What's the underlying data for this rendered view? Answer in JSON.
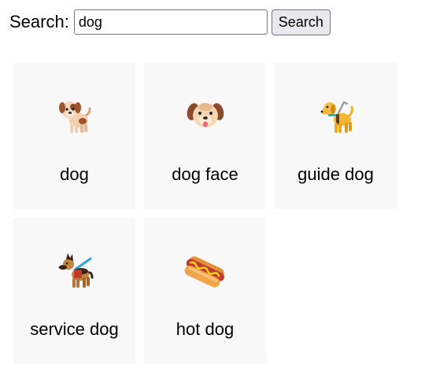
{
  "search": {
    "label": "Search:",
    "value": "dog",
    "button_label": "Search"
  },
  "results": [
    {
      "label": "dog",
      "icon": "dog-icon"
    },
    {
      "label": "dog face",
      "icon": "dog-face-icon"
    },
    {
      "label": "guide dog",
      "icon": "guide-dog-icon"
    },
    {
      "label": "service dog",
      "icon": "service-dog-icon"
    },
    {
      "label": "hot dog",
      "icon": "hot-dog-icon"
    }
  ],
  "colors": {
    "card_background": "#f8f8f8",
    "button_background": "#e9e9ed"
  }
}
